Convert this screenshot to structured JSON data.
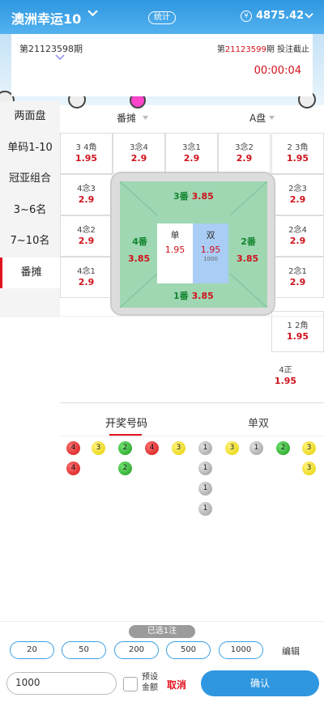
{
  "header": {
    "title": "澳洲幸运10",
    "stats_label": "统计",
    "currency_symbol": "¥",
    "balance": "4875.42"
  },
  "draw": {
    "prev_period": "第21123598期",
    "current_prefix": "第",
    "current_num": "21123599",
    "current_suffix": "期 投注截止",
    "countdown": "00:00:04"
  },
  "sidebar": {
    "items": [
      {
        "label": "两面盘"
      },
      {
        "label": "单码1-10"
      },
      {
        "label": "冠亚组合"
      },
      {
        "label": "3~6名"
      },
      {
        "label": "7~10名"
      },
      {
        "label": "番摊"
      }
    ]
  },
  "subtabs": {
    "left": "番摊",
    "right": "A盘"
  },
  "cells": [
    {
      "name": "3 4角",
      "odds": "1.95"
    },
    {
      "name": "3念4",
      "odds": "2.9"
    },
    {
      "name": "3念1",
      "odds": "2.9"
    },
    {
      "name": "3念2",
      "odds": "2.9"
    },
    {
      "name": "2 3角",
      "odds": "1.95"
    },
    {
      "name": "4念3",
      "odds": "2.9"
    },
    {
      "name": "2念3",
      "odds": "2.9"
    },
    {
      "name": "4念2",
      "odds": "2.9"
    },
    {
      "name": "2念4",
      "odds": "2.9"
    },
    {
      "name": "4念1",
      "odds": "2.9"
    },
    {
      "name": "2念1",
      "odds": "2.9"
    },
    {
      "name": "1 2角",
      "odds": "1.95"
    },
    {
      "name": "4正",
      "odds": "1.95"
    }
  ],
  "board": {
    "top": {
      "label": "3番",
      "odds": "3.85"
    },
    "bottom": {
      "label": "1番",
      "odds": "3.85"
    },
    "left": {
      "label": "4番",
      "odds": "3.85"
    },
    "right": {
      "label": "2番",
      "odds": "3.85"
    },
    "single": {
      "label": "单",
      "odds": "1.95"
    },
    "double": {
      "label": "双",
      "odds": "1.95",
      "amount": "1000"
    }
  },
  "result_tabs": {
    "numbers": "开奖号码",
    "oddeven": "单双"
  },
  "balls": [
    {
      "n": "4",
      "c": "r"
    },
    {
      "n": "3",
      "c": "y"
    },
    {
      "n": "2",
      "c": "g"
    },
    {
      "n": "4",
      "c": "r"
    },
    {
      "n": "3",
      "c": "y"
    },
    {
      "n": "1",
      "c": "s"
    },
    {
      "n": "3",
      "c": "y"
    },
    {
      "n": "1",
      "c": "s"
    },
    {
      "n": "2",
      "c": "g"
    },
    {
      "n": "3",
      "c": "y"
    },
    {
      "n": "4",
      "c": "r"
    },
    {
      "n": "2",
      "c": "g"
    },
    {
      "n": "1",
      "c": "s"
    },
    {
      "n": "3",
      "c": "y"
    },
    {
      "n": "1",
      "c": "s"
    },
    {
      "n": "1",
      "c": "s"
    }
  ],
  "footer": {
    "selected": "已选1注",
    "chips": [
      "20",
      "50",
      "200",
      "500",
      "1000"
    ],
    "edit": "编辑",
    "amount": "1000",
    "preset": "预设金额",
    "cancel": "取消",
    "confirm": "确认"
  },
  "colors": {
    "primary": "#2f97e0",
    "red": "#d0121b",
    "green": "#13862f",
    "board": "#9fd7b3"
  }
}
